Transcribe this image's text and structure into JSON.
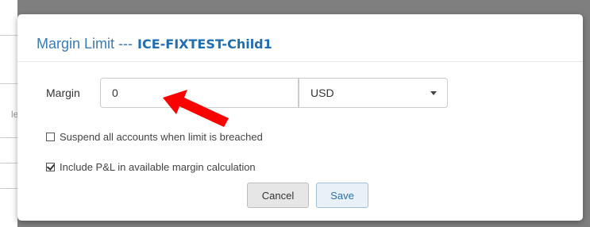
{
  "backdrop": {
    "ghost_text": "le"
  },
  "modal": {
    "title_prefix": "Margin Limit ---",
    "account_name": "ICE-FIXTEST-Child1"
  },
  "form": {
    "margin_label": "Margin",
    "margin_value": "0",
    "currency_value": "USD",
    "suspend_label": "Suspend all accounts when limit is breached",
    "suspend_checked": false,
    "include_pl_label": "Include P&L in available margin calculation",
    "include_pl_checked": true
  },
  "buttons": {
    "cancel_label": "Cancel",
    "save_label": "Save"
  },
  "colors": {
    "title_color": "#3a7bb8",
    "annotation_arrow": "#ff0000"
  }
}
